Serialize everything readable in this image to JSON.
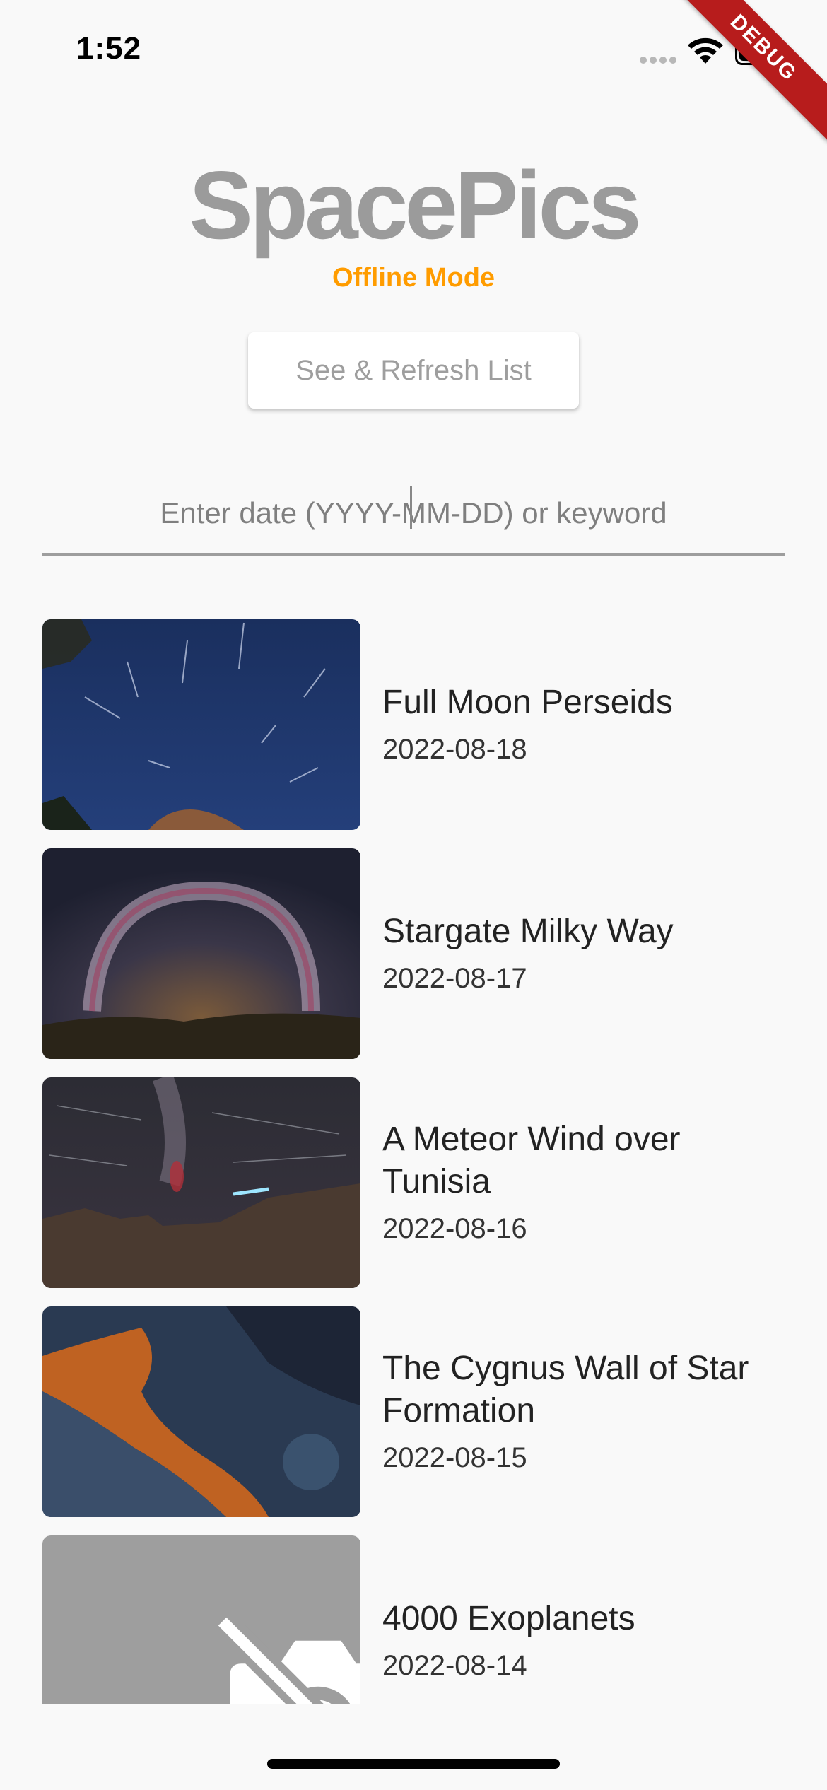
{
  "status_bar": {
    "time": "1:52"
  },
  "debug_banner": "DEBUG",
  "header": {
    "title": "SpacePics",
    "subtitle": "Offline Mode",
    "refresh_button": "See & Refresh List"
  },
  "search": {
    "placeholder": "Enter date (YYYY-MM-DD) or keyword",
    "value": ""
  },
  "items": [
    {
      "title": "Full Moon Perseids",
      "date": "2022-08-18"
    },
    {
      "title": "Stargate Milky Way",
      "date": "2022-08-17"
    },
    {
      "title": "A Meteor Wind over Tunisia",
      "date": "2022-08-16"
    },
    {
      "title": "The Cygnus Wall of Star Formation",
      "date": "2022-08-15"
    },
    {
      "title": "4000 Exoplanets",
      "date": "2022-08-14"
    }
  ],
  "icons": {
    "no_image": "no-photography-icon"
  },
  "colors": {
    "accent": "#ff9c00",
    "title": "#9b9b9b",
    "debug": "#b71c1c"
  }
}
